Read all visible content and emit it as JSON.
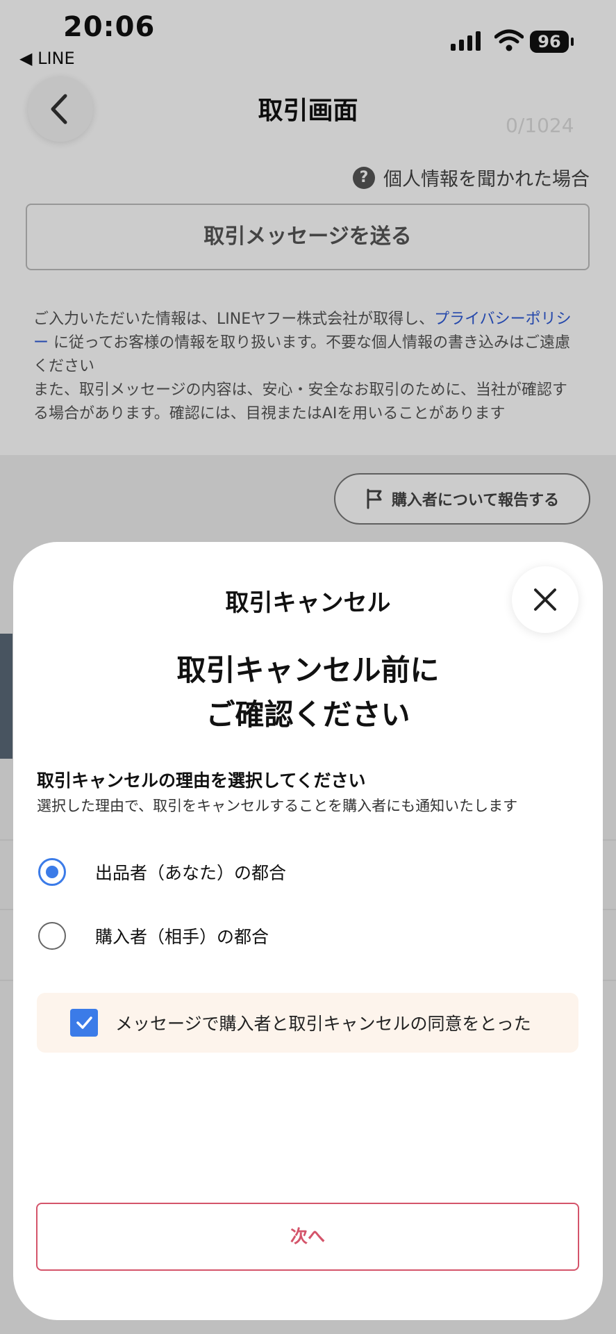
{
  "status_bar": {
    "time": "20:06",
    "back_app": "◀ LINE",
    "battery": "96"
  },
  "nav": {
    "title": "取引画面",
    "counter": "0/1024"
  },
  "privacy_help": "個人情報を聞かれた場合",
  "send_message_label": "取引メッセージを送る",
  "disclaimer": {
    "pre": "ご入力いただいた情報は、LINEヤフー株式会社が取得し、",
    "link": "プライバシーポリシー",
    "post": " に従ってお客様の情報を取り扱います。不要な個人情報の書き込みはご遠慮ください",
    "line2": "また、取引メッセージの内容は、安心・安全なお取引のために、当社が確認する場合があります。確認には、目視またはAIを用いることがあります"
  },
  "report_label": "購入者について報告する",
  "modal": {
    "title": "取引キャンセル",
    "headline_line1": "取引キャンセル前に",
    "headline_line2": "ご確認ください",
    "reason_title": "取引キャンセルの理由を選択してください",
    "reason_subtitle": "選択した理由で、取引をキャンセルすることを購入者にも通知いたします",
    "options": [
      {
        "label": "出品者（あなた）の都合",
        "selected": true
      },
      {
        "label": "購入者（相手）の都合",
        "selected": false
      }
    ],
    "agree_label": "メッセージで購入者と取引キャンセルの同意をとった",
    "agree_checked": true,
    "next_label": "次へ"
  },
  "colors": {
    "accent": "#3b7be8",
    "danger": "#d4546a",
    "link": "#2f5bd6",
    "agree_bg": "#fdf4ec"
  }
}
